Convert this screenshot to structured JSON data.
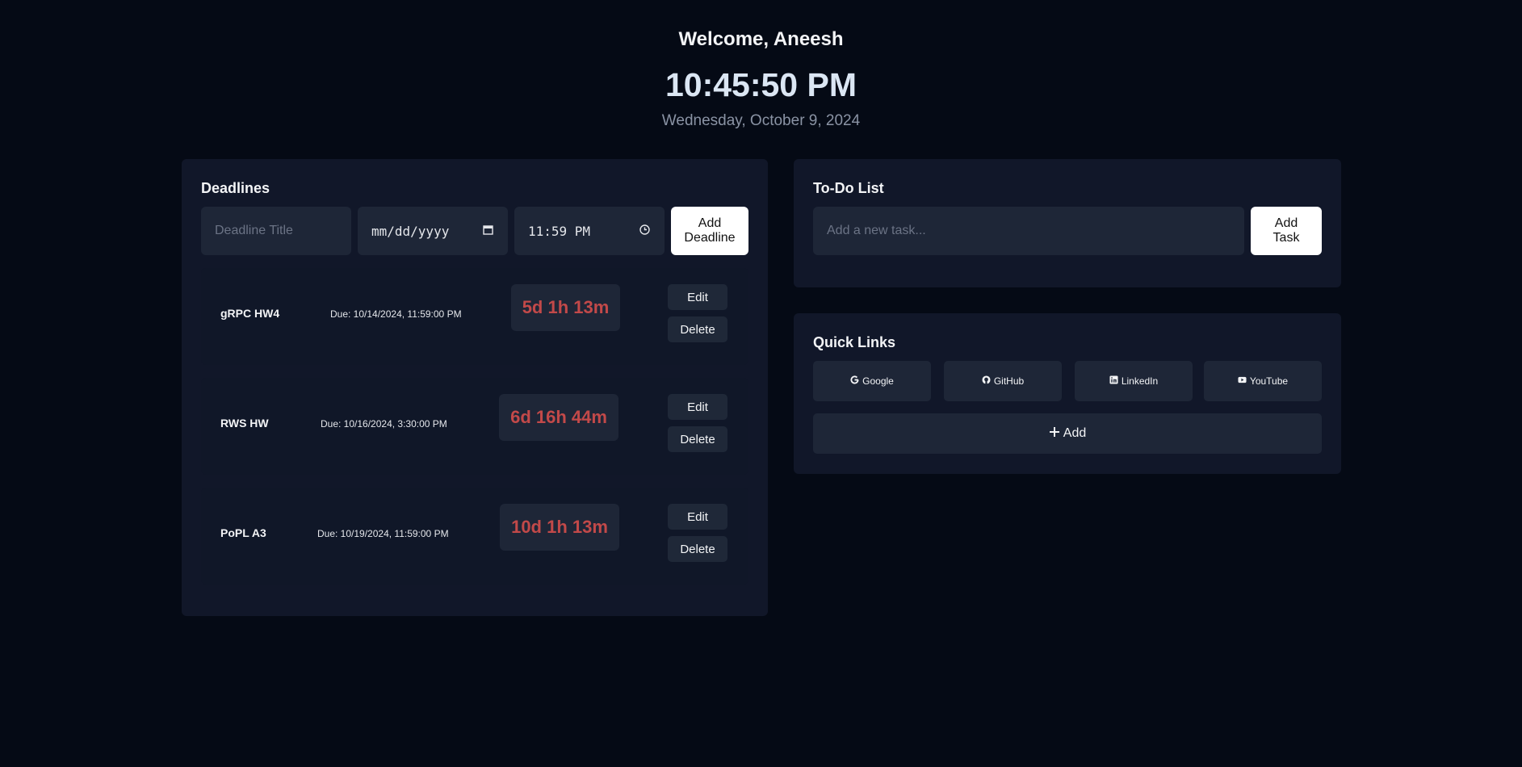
{
  "header": {
    "welcome": "Welcome, Aneesh",
    "time": "10:45:50 PM",
    "date": "Wednesday, October 9, 2024"
  },
  "deadlines": {
    "title": "Deadlines",
    "title_placeholder": "Deadline Title",
    "date_value": "mm/dd/yyyy",
    "time_value": "11:59 PM",
    "add_label": "Add Deadline",
    "edit_label": "Edit",
    "delete_label": "Delete",
    "items": [
      {
        "name": "gRPC HW4",
        "due": "Due: 10/14/2024, 11:59:00 PM",
        "countdown": "5d 1h 13m"
      },
      {
        "name": "RWS HW",
        "due": "Due: 10/16/2024, 3:30:00 PM",
        "countdown": "6d 16h 44m"
      },
      {
        "name": "PoPL A3",
        "due": "Due: 10/19/2024, 11:59:00 PM",
        "countdown": "10d 1h 13m"
      }
    ]
  },
  "todo": {
    "title": "To-Do List",
    "placeholder": "Add a new task...",
    "add_label": "Add Task"
  },
  "quick_links": {
    "title": "Quick Links",
    "links": [
      {
        "label": "Google",
        "icon": "google-icon"
      },
      {
        "label": "GitHub",
        "icon": "github-icon"
      },
      {
        "label": "LinkedIn",
        "icon": "linkedin-icon"
      },
      {
        "label": "YouTube",
        "icon": "youtube-icon"
      }
    ],
    "add_label": "Add"
  },
  "colors": {
    "background": "#050a15",
    "panel": "#111729",
    "countdown": "#c24949"
  }
}
